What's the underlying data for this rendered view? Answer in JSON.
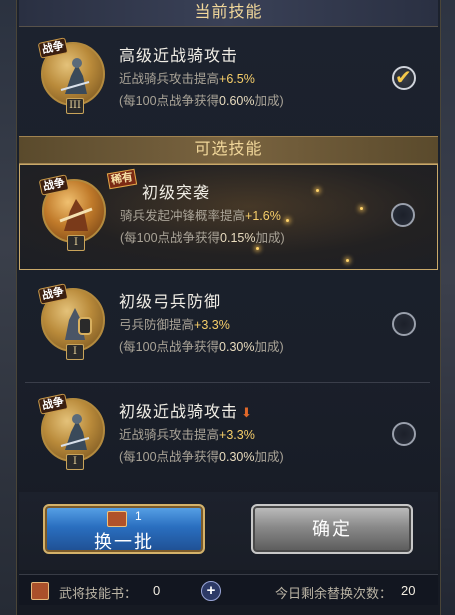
{
  "headers": {
    "current": "当前技能",
    "optional": "可选技能"
  },
  "current_skill": {
    "tag": "战争",
    "tier": "III",
    "title": "高级近战骑攻击",
    "desc_prefix": "近战骑兵攻击提高",
    "desc_value": "+6.5%",
    "sub_prefix": "(每100点战争获得",
    "sub_value": "0.60%",
    "sub_suffix": "加成)",
    "selected": true
  },
  "options": [
    {
      "tag": "战争",
      "badge": "稀有",
      "tier": "I",
      "title": "初级突袭",
      "desc_prefix": "骑兵发起冲锋概率提高",
      "desc_value": "+1.6%",
      "sub_prefix": "(每100点战争获得",
      "sub_value": "0.15%",
      "sub_suffix": "加成)",
      "selected": false
    },
    {
      "tag": "战争",
      "tier": "I",
      "title": "初级弓兵防御",
      "desc_prefix": "弓兵防御提高",
      "desc_value": "+3.3%",
      "sub_prefix": "(每100点战争获得",
      "sub_value": "0.30%",
      "sub_suffix": "加成)",
      "selected": false
    },
    {
      "tag": "战争",
      "tier": "I",
      "title": "初级近战骑攻击",
      "desc_prefix": "近战骑兵攻击提高",
      "desc_value": "+3.3%",
      "sub_prefix": "(每100点战争获得",
      "sub_value": "0.30%",
      "sub_suffix": "加成)",
      "selected": false,
      "downgrade_icon": "down-arrow-icon"
    }
  ],
  "buttons": {
    "swap_label": "换一批",
    "swap_cost": "1",
    "confirm_label": "确定"
  },
  "footer": {
    "books_label": "武将技能书：",
    "books_count": "0",
    "plus": "+",
    "swaps_label": "今日剩余替换次数：",
    "swaps_count": "20"
  },
  "colors": {
    "highlight": "#f7cf6a",
    "gold_border": "#c9a96a",
    "swap_button": "#2a6fc0",
    "confirm_button": "#8a8a8a"
  }
}
